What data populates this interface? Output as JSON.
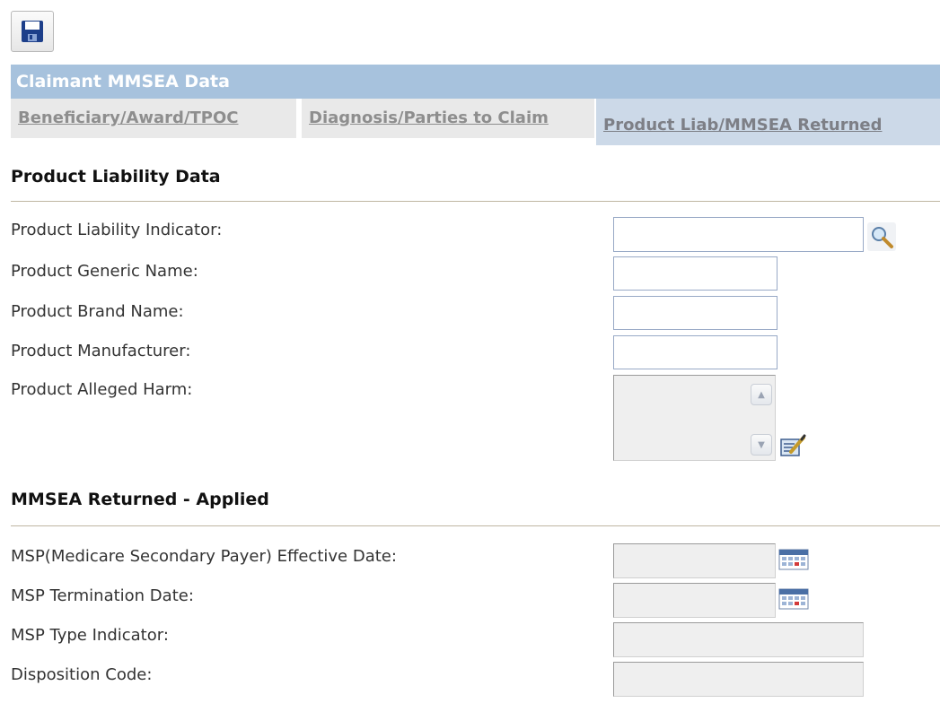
{
  "toolbar": {
    "save_icon": "save-floppy-icon"
  },
  "section_header": "Claimant MMSEA Data",
  "tabs": [
    {
      "label": "Beneficiary/Award/TPOC",
      "active": false
    },
    {
      "label": "Diagnosis/Parties to Claim",
      "active": false
    },
    {
      "label": "Product Liab/MMSEA Returned",
      "active": true
    }
  ],
  "product_liability": {
    "heading": "Product Liability Data",
    "fields": [
      {
        "label": "Product Liability Indicator:",
        "value": "",
        "icon": "search-icon"
      },
      {
        "label": "Product Generic Name:",
        "value": ""
      },
      {
        "label": "Product Brand Name:",
        "value": ""
      },
      {
        "label": "Product Manufacturer:",
        "value": ""
      },
      {
        "label": "Product Alleged Harm:",
        "value": "",
        "icon": "edit-notes-icon"
      }
    ]
  },
  "mmsea_returned": {
    "heading": "MMSEA Returned - Applied",
    "fields": [
      {
        "label": "MSP(Medicare Secondary Payer) Effective Date:",
        "value": "",
        "icon": "calendar-icon"
      },
      {
        "label": "MSP Termination Date:",
        "value": "",
        "icon": "calendar-icon"
      },
      {
        "label": "MSP Type Indicator:",
        "value": ""
      },
      {
        "label": "Disposition Code:",
        "value": ""
      }
    ]
  },
  "colors": {
    "header_bg": "#a7c2dd",
    "active_tab_bg": "#ccd9e8",
    "inactive_tab_bg": "#e9e9e9",
    "field_border": "#98a9c6",
    "disabled_bg": "#efefef"
  }
}
